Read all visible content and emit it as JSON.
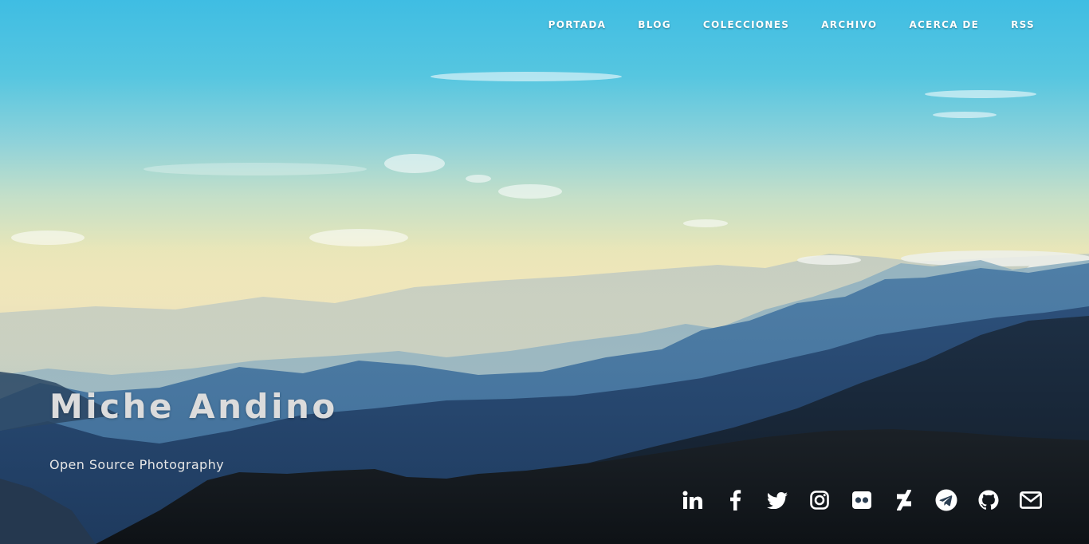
{
  "nav": {
    "items": [
      {
        "label": "PORTADA"
      },
      {
        "label": "BLOG"
      },
      {
        "label": "COLECCIONES"
      },
      {
        "label": "ARCHIVO"
      },
      {
        "label": "ACERCA DE"
      },
      {
        "label": "RSS"
      }
    ]
  },
  "hero": {
    "title": "Miche Andino",
    "subtitle": "Open Source Photography"
  },
  "social": [
    {
      "icon": "linkedin-icon"
    },
    {
      "icon": "facebook-icon"
    },
    {
      "icon": "twitter-icon"
    },
    {
      "icon": "instagram-icon"
    },
    {
      "icon": "flickr-icon"
    },
    {
      "icon": "deviantart-icon"
    },
    {
      "icon": "telegram-icon"
    },
    {
      "icon": "github-icon"
    },
    {
      "icon": "envelope-icon"
    }
  ],
  "colors": {
    "nav_text": "#ffffff",
    "title_text": "#dcdcdc",
    "icon_color": "#ffffff"
  }
}
